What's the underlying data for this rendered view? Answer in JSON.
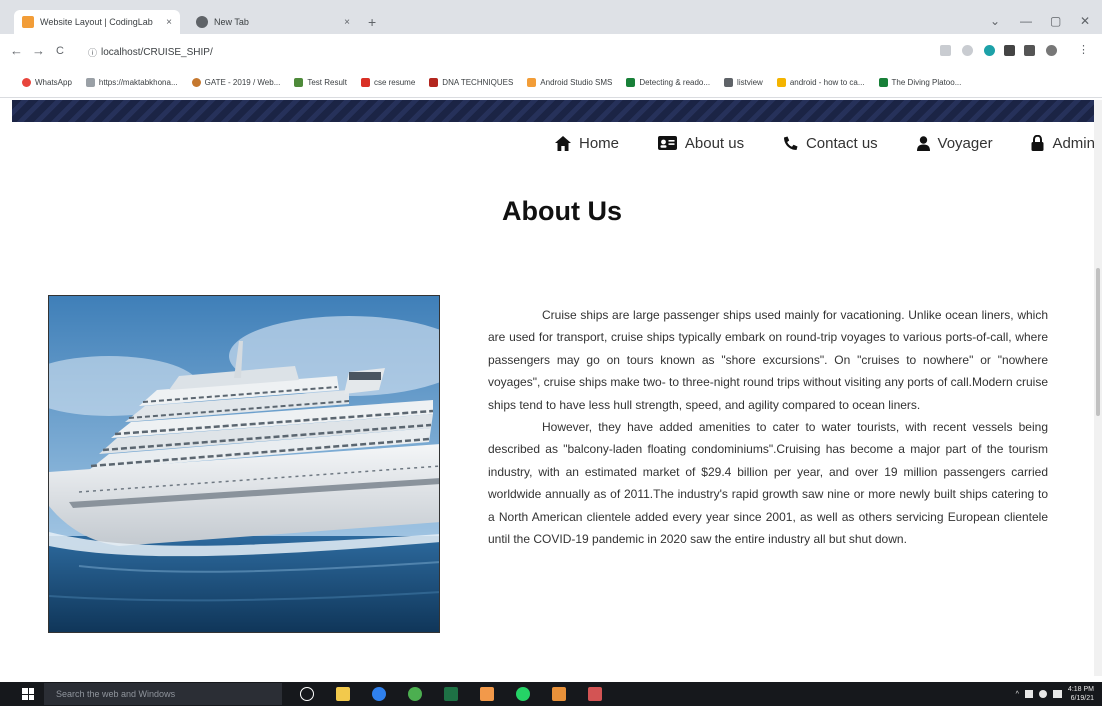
{
  "browser": {
    "tabs": [
      {
        "title": "Website Layout | CodingLab",
        "close": "×",
        "favicon_color": "#f29d38"
      },
      {
        "title": "New Tab",
        "close": "×",
        "favicon_color": "#5f6368"
      }
    ],
    "new_tab": "+",
    "window_controls": {
      "minimize": "—",
      "maximize": "▢",
      "close": "✕"
    },
    "address": "localhost/CRUISE_SHIP/",
    "nav": {
      "back": "←",
      "forward": "→",
      "reload": "C"
    }
  },
  "bookmarks": [
    {
      "label": "WhatsApp",
      "color": "#e8453c"
    },
    {
      "label": "https://maktabkhona...",
      "color": "#9aa0a6"
    },
    {
      "label": "GATE - 2019 / Web...",
      "color": "#c5782f"
    },
    {
      "label": "Test Result",
      "color": "#4e8a3a"
    },
    {
      "label": "cse resume",
      "color": "#d93025"
    },
    {
      "label": "DNA TECHNIQUES",
      "color": "#b3261e"
    },
    {
      "label": "Android Studio SMS",
      "color": "#f29d38"
    },
    {
      "label": "Detecting & reado...",
      "color": "#188038"
    },
    {
      "label": "listview",
      "color": "#5f6368"
    },
    {
      "label": "android - how to ca...",
      "color": "#f4b400"
    },
    {
      "label": "The Diving Platoo...",
      "color": "#188038"
    }
  ],
  "navbar": {
    "items": [
      {
        "label": "Home",
        "icon": "home-icon"
      },
      {
        "label": "About us",
        "icon": "id-card-icon"
      },
      {
        "label": "Contact us",
        "icon": "phone-icon"
      },
      {
        "label": "Voyager",
        "icon": "user-icon"
      },
      {
        "label": "Admin",
        "icon": "lock-icon"
      }
    ]
  },
  "page": {
    "heading": "About Us",
    "paragraphs": [
      "Cruise ships are large passenger ships used mainly for vacationing. Unlike ocean liners, which are used for transport, cruise ships typically embark on round-trip voyages to various ports-of-call, where passengers may go on tours known as \"shore excursions\". On \"cruises to nowhere\" or \"nowhere voyages\", cruise ships make two- to three-night round trips without visiting any ports of call.Modern cruise ships tend to have less hull strength, speed, and agility compared to ocean liners.",
      "However, they have added amenities to cater to water tourists, with recent vessels being described as \"balcony-laden floating condominiums\".Cruising has become a major part of the tourism industry, with an estimated market of $29.4 billion per year, and over 19 million passengers carried worldwide annually as of 2011.The industry's rapid growth saw nine or more newly built ships catering to a North American clientele added every year since 2001, as well as others servicing European clientele until the COVID-19 pandemic in 2020 saw the entire industry all but shut down."
    ]
  },
  "taskbar": {
    "search_placeholder": "Search the web and Windows",
    "time": "4:18 PM",
    "date": "6/19/21",
    "apps": [
      {
        "name": "task-view",
        "color": "#ffffff"
      },
      {
        "name": "file-explorer",
        "color": "#f2c94c"
      },
      {
        "name": "edge",
        "color": "#2f80ed"
      },
      {
        "name": "chrome",
        "color": "#4caf50"
      },
      {
        "name": "excel",
        "color": "#1e7145"
      },
      {
        "name": "paint",
        "color": "#f2994a"
      },
      {
        "name": "whatsapp",
        "color": "#25d366"
      },
      {
        "name": "store",
        "color": "#e8913a"
      },
      {
        "name": "photos",
        "color": "#d35454"
      }
    ]
  }
}
